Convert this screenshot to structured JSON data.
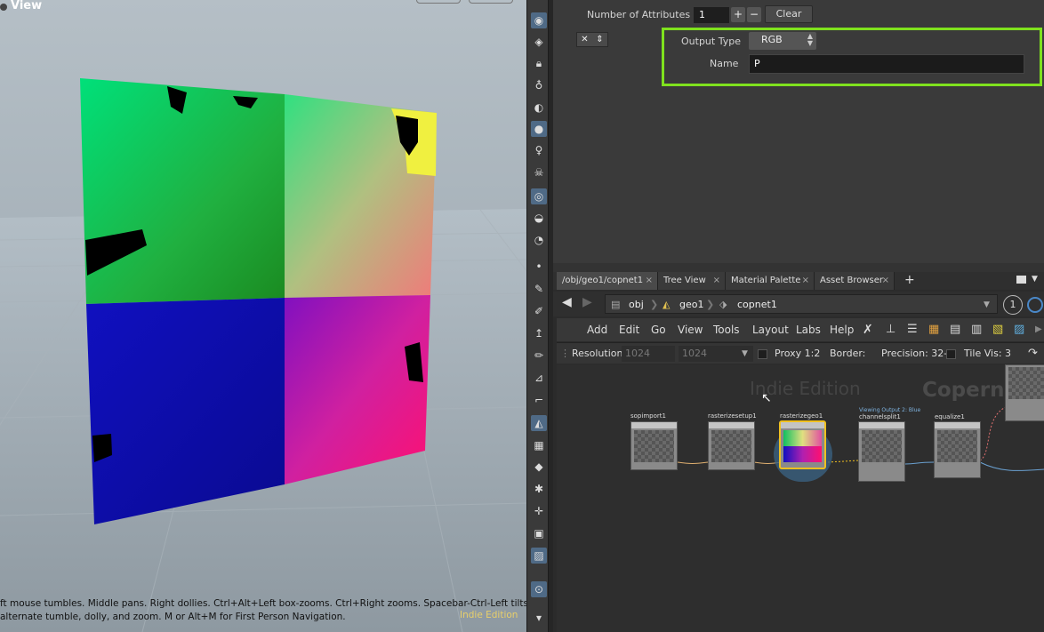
{
  "viewport": {
    "title": "View",
    "help_line1": "ft mouse tumbles. Middle pans. Right dollies. Ctrl+Alt+Left box-zooms. Ctrl+Right zooms. Spacebar-Ctrl-Left tilts. Hold L",
    "help_line2": "alternate tumble, dolly, and zoom. M or Alt+M for First Person Navigation.",
    "watermark": "Indie Edition"
  },
  "params": {
    "num_attr_label": "Number of Attributes",
    "num_attr_value": "1",
    "plus": "+",
    "minus": "−",
    "clear_label": "Clear",
    "remove": "✕",
    "move": "⇕",
    "output_type_label": "Output Type",
    "output_type_value": "RGB",
    "name_label": "Name",
    "name_value": "P"
  },
  "tabs": [
    {
      "label": "/obj/geo1/copnet1"
    },
    {
      "label": "Tree View"
    },
    {
      "label": "Material Palette"
    },
    {
      "label": "Asset Browser"
    }
  ],
  "path": {
    "obj": "obj",
    "geo": "geo1",
    "cop": "copnet1",
    "badge": "1"
  },
  "menu": {
    "add": "Add",
    "edit": "Edit",
    "go": "Go",
    "view": "View",
    "tools": "Tools",
    "layout": "Layout",
    "labs": "Labs",
    "help": "Help"
  },
  "netbar": {
    "resolution": "Resolution",
    "res_x": "1024",
    "res_y": "1024",
    "proxy": "Proxy 1:2",
    "border": "Border:",
    "precision": "Precision: 32-",
    "tilevis": "Tile Vis: 3"
  },
  "network": {
    "watermark_indie": "Indie Edition",
    "watermark_cop": "Copernicus",
    "nodes": [
      {
        "name": "sopimport1"
      },
      {
        "name": "rasterizesetup1"
      },
      {
        "name": "rasterizegeo1"
      },
      {
        "name": "channelsplit1",
        "sub": "Viewing Output 2: Blue"
      },
      {
        "name": "equalize1"
      }
    ]
  },
  "colors": {
    "highlight": "#7fe21e",
    "selected_node": "#f0c020",
    "accent": "#4f6a86"
  }
}
